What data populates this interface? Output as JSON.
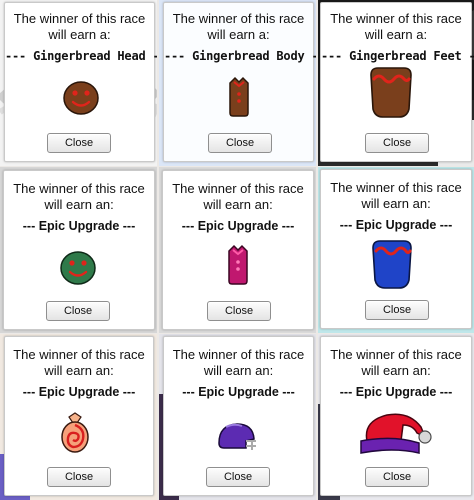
{
  "dialogs": [
    {
      "line1": "The winner of this race",
      "line2": "will earn a:",
      "prize": "--- Gingerbread Head ---",
      "icon": "gingerbread-head-icon",
      "button": "Close"
    },
    {
      "line1": "The winner of this race",
      "line2": "will earn a:",
      "prize": "--- Gingerbread Body ---",
      "icon": "gingerbread-body-icon",
      "button": "Close"
    },
    {
      "line1": "The winner of this race",
      "line2": "will earn a:",
      "prize": "--- Gingerbread Feet ---",
      "icon": "gingerbread-feet-icon",
      "button": "Close"
    },
    {
      "line1": "The winner of this race",
      "line2": "will earn an:",
      "prize": "--- Epic Upgrade ---",
      "icon": "epic-green-head-icon",
      "button": "Close"
    },
    {
      "line1": "The winner of this race",
      "line2": "will earn an:",
      "prize": "--- Epic Upgrade ---",
      "icon": "epic-magenta-body-icon",
      "button": "Close"
    },
    {
      "line1": "The winner of this race",
      "line2": "will earn an:",
      "prize": "--- Epic Upgrade ---",
      "icon": "epic-blue-feet-icon",
      "button": "Close"
    },
    {
      "line1": "The winner of this race",
      "line2": "will earn an:",
      "prize": "--- Epic Upgrade ---",
      "icon": "epic-candy-icon",
      "button": "Close"
    },
    {
      "line1": "The winner of this race",
      "line2": "will earn an:",
      "prize": "--- Epic Upgrade ---",
      "icon": "epic-helmet-icon",
      "button": "Close"
    },
    {
      "line1": "The winner of this race",
      "line2": "will earn an:",
      "prize": "--- Epic Upgrade ---",
      "icon": "epic-santa-hat-icon",
      "button": "Close"
    }
  ],
  "colors": {
    "gingerbread": "#7a3f1c",
    "icing": "#e0241b",
    "epic_green": "#2f7a4a",
    "epic_magenta": "#c0186f",
    "epic_blue": "#1f44c8",
    "helmet_purple": "#5c2bb2",
    "hat_red": "#e1122a"
  }
}
